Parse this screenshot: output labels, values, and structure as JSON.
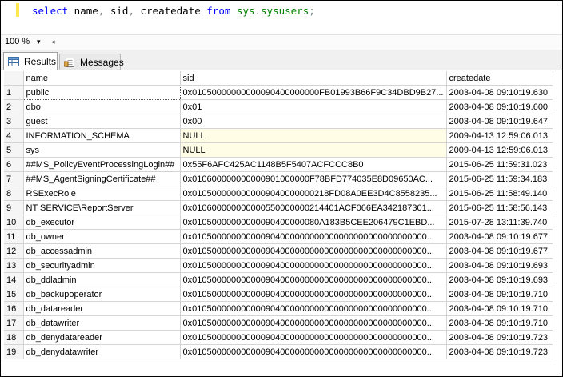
{
  "editor": {
    "tokens": [
      {
        "text": "select",
        "kind": "kw"
      },
      {
        "text": " name",
        "kind": "plain"
      },
      {
        "text": ",",
        "kind": "pun"
      },
      {
        "text": " sid",
        "kind": "plain"
      },
      {
        "text": ",",
        "kind": "pun"
      },
      {
        "text": " createdate ",
        "kind": "plain"
      },
      {
        "text": "from",
        "kind": "kw"
      },
      {
        "text": " ",
        "kind": "plain"
      },
      {
        "text": "sys",
        "kind": "sys"
      },
      {
        "text": ".",
        "kind": "pun"
      },
      {
        "text": "sysusers",
        "kind": "sys"
      },
      {
        "text": ";",
        "kind": "pun"
      }
    ]
  },
  "zoom": {
    "value": "100 %"
  },
  "tabs": {
    "results": "Results",
    "messages": "Messages"
  },
  "grid": {
    "columns": [
      "name",
      "sid",
      "createdate"
    ],
    "rows": [
      {
        "n": "1",
        "name": "public",
        "sid": "0x01050000000000090400000000FB01993B66F9C34DBD9B27...",
        "createdate": "2003-04-08 09:10:19.630"
      },
      {
        "n": "2",
        "name": "dbo",
        "sid": "0x01",
        "createdate": "2003-04-08 09:10:19.600"
      },
      {
        "n": "3",
        "name": "guest",
        "sid": "0x00",
        "createdate": "2003-04-08 09:10:19.647"
      },
      {
        "n": "4",
        "name": "INFORMATION_SCHEMA",
        "sid": "NULL",
        "createdate": "2009-04-13 12:59:06.013",
        "null": true
      },
      {
        "n": "5",
        "name": "sys",
        "sid": "NULL",
        "createdate": "2009-04-13 12:59:06.013",
        "null": true
      },
      {
        "n": "6",
        "name": "##MS_PolicyEventProcessingLogin##",
        "sid": "0x55F6AFC425AC1148B5F5407ACFCCC8B0",
        "createdate": "2015-06-25 11:59:31.023"
      },
      {
        "n": "7",
        "name": "##MS_AgentSigningCertificate##",
        "sid": "0x010600000000000901000000F78BFD774035E8D09650AC...",
        "createdate": "2015-06-25 11:59:34.183"
      },
      {
        "n": "8",
        "name": "RSExecRole",
        "sid": "0x0105000000000009040000000218FD08A0EE3D4C8558235...",
        "createdate": "2015-06-25 11:58:49.140"
      },
      {
        "n": "9",
        "name": "NT SERVICE\\ReportServer",
        "sid": "0x010600000000000550000000214401ACF066EA342187301...",
        "createdate": "2015-06-25 11:58:56.143"
      },
      {
        "n": "10",
        "name": "db_executor",
        "sid": "0x01050000000000090400000080A183B5CEE206479C1EBD...",
        "createdate": "2015-07-28 13:11:39.740"
      },
      {
        "n": "11",
        "name": "db_owner",
        "sid": "0x010500000000000904000000000000000000000000000000...",
        "createdate": "2003-04-08 09:10:19.677"
      },
      {
        "n": "12",
        "name": "db_accessadmin",
        "sid": "0x010500000000000904000000000000000000000000000000...",
        "createdate": "2003-04-08 09:10:19.677"
      },
      {
        "n": "13",
        "name": "db_securityadmin",
        "sid": "0x010500000000000904000000000000000000000000000000...",
        "createdate": "2003-04-08 09:10:19.693"
      },
      {
        "n": "14",
        "name": "db_ddladmin",
        "sid": "0x010500000000000904000000000000000000000000000000...",
        "createdate": "2003-04-08 09:10:19.693"
      },
      {
        "n": "15",
        "name": "db_backupoperator",
        "sid": "0x010500000000000904000000000000000000000000000000...",
        "createdate": "2003-04-08 09:10:19.710"
      },
      {
        "n": "16",
        "name": "db_datareader",
        "sid": "0x010500000000000904000000000000000000000000000000...",
        "createdate": "2003-04-08 09:10:19.710"
      },
      {
        "n": "17",
        "name": "db_datawriter",
        "sid": "0x010500000000000904000000000000000000000000000000...",
        "createdate": "2003-04-08 09:10:19.710"
      },
      {
        "n": "18",
        "name": "db_denydatareader",
        "sid": "0x010500000000000904000000000000000000000000000000...",
        "createdate": "2003-04-08 09:10:19.723"
      },
      {
        "n": "19",
        "name": "db_denydatawriter",
        "sid": "0x010500000000000904000000000000000000000000000000...",
        "createdate": "2003-04-08 09:10:19.723"
      }
    ]
  }
}
